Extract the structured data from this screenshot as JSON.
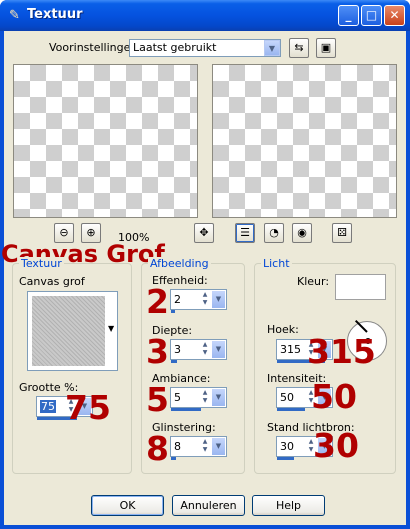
{
  "window": {
    "title": "Textuur",
    "app_icon": "paint-icon",
    "controls": {
      "minimize": "_",
      "maximize": "□",
      "close": "✕"
    }
  },
  "presets": {
    "label": "Voorinstellingen:",
    "value": "Laatst gebruikt"
  },
  "zoom": {
    "percent": "100%"
  },
  "overlay_title": "Canvas Grof",
  "texture_group": {
    "title": "Textuur",
    "name": "Canvas grof",
    "size_label": "Grootte %:",
    "size_value": "75",
    "size_badge": "75"
  },
  "image_group": {
    "title": "Afbeelding",
    "smoothness_label": "Effenheid:",
    "smoothness_value": "2",
    "smoothness_badge": "2",
    "depth_label": "Diepte:",
    "depth_value": "3",
    "depth_badge": "3",
    "ambience_label": "Ambiance:",
    "ambience_value": "5",
    "ambience_badge": "5",
    "shine_label": "Glinstering:",
    "shine_value": "8",
    "shine_badge": "8"
  },
  "light_group": {
    "title": "Licht",
    "color_label": "Kleur:",
    "color_value": "#ffffff",
    "angle_label": "Hoek:",
    "angle_value": "315",
    "angle_badge": "315",
    "intensity_label": "Intensiteit:",
    "intensity_value": "50",
    "intensity_badge": "50",
    "position_label": "Stand lichtbron:",
    "position_value": "30",
    "position_badge": "30"
  },
  "buttons": {
    "ok": "OK",
    "cancel": "Annuleren",
    "help": "Help"
  },
  "colors": {
    "accent": "#0046d5",
    "annotation": "#b00000",
    "titlebar": "#0552df"
  }
}
